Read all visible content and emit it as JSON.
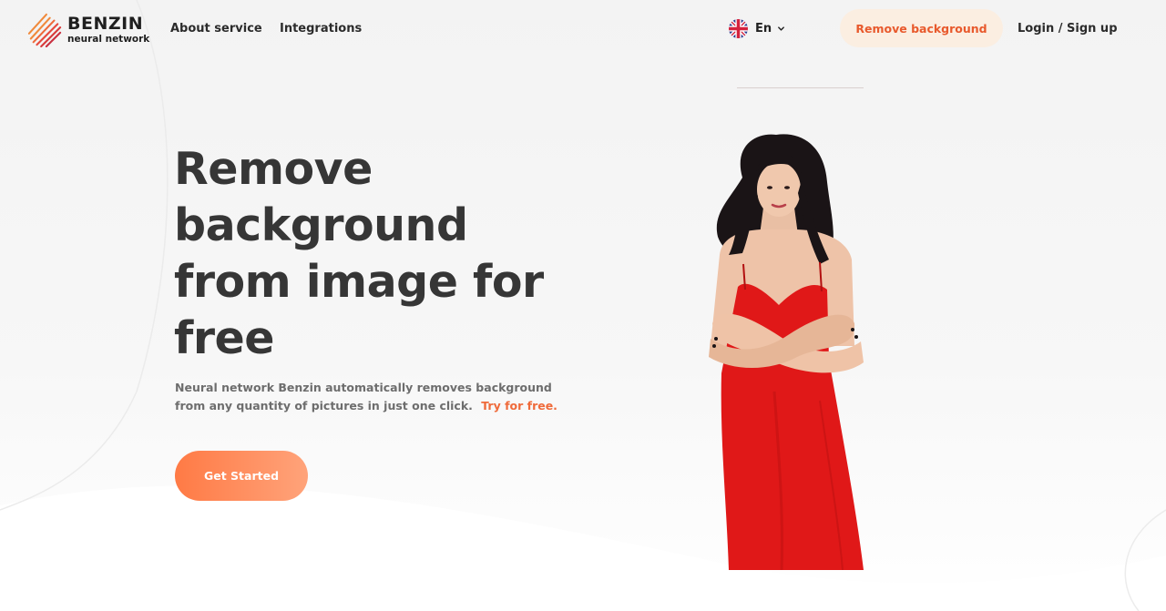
{
  "header": {
    "logo_name": "BENZIN",
    "logo_sub": "neural network",
    "nav": [
      {
        "label": "About service"
      },
      {
        "label": "Integrations"
      }
    ],
    "language": "En",
    "remove_bg_label": "Remove background",
    "login_label": "Login / Sign up"
  },
  "hero": {
    "title": "Remove background from image for free",
    "description": "Neural network Benzin automatically removes background from any quantity of pictures in just one click.",
    "try_link": "Try for free.",
    "cta_label": "Get Started"
  },
  "colors": {
    "accent": "#ef6a3a",
    "accent_light_bg": "#fbeee1",
    "title_text": "#363636",
    "body_text": "#6d6d6d",
    "dress_red": "#e01818"
  },
  "icons": {
    "logo": "benzin-logo-icon",
    "flag": "uk-flag-icon",
    "chevron": "chevron-down-icon"
  }
}
